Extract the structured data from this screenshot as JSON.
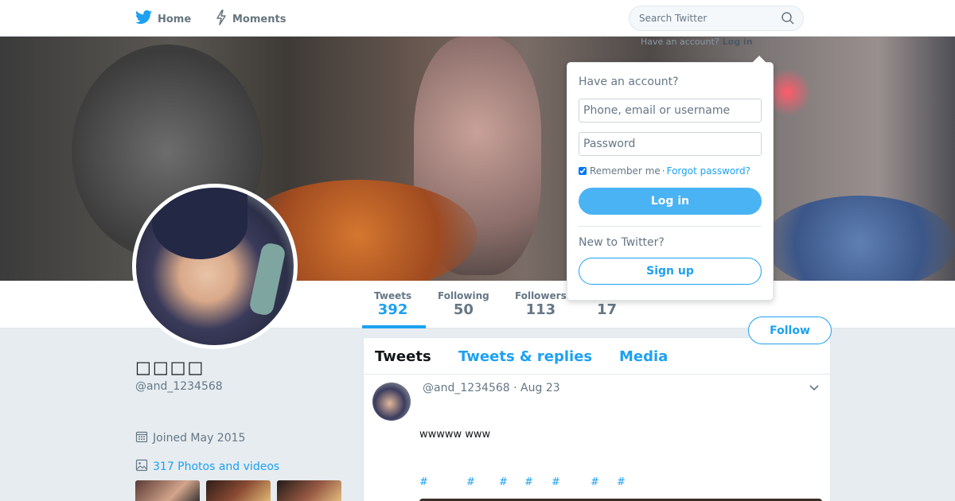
{
  "nav": {
    "home_label": "Home",
    "moments_label": "Moments",
    "search_placeholder": "Search Twitter",
    "have_account_text": "Have an account?",
    "login_link": "Log in"
  },
  "stats": {
    "tweets_label": "Tweets",
    "tweets_value": "392",
    "following_label": "Following",
    "following_value": "50",
    "followers_label": "Followers",
    "followers_value": "113",
    "likes_value": "17"
  },
  "profile": {
    "name": "□□□□",
    "handle": "@and_1234568",
    "joined": "Joined May 2015",
    "photos_link": "317 Photos and videos",
    "follow_label": "Follow"
  },
  "timeline": {
    "tabs": [
      "Tweets",
      "Tweets & replies",
      "Media"
    ],
    "tweet": {
      "meta": "@and_1234568 · Aug 23",
      "text": "wwwww www",
      "hashtags": [
        "#",
        "#",
        "#",
        "#",
        "#",
        "#",
        "#"
      ]
    }
  },
  "login_dropdown": {
    "title": "Have an account?",
    "username_placeholder": "Phone, email or username",
    "password_placeholder": "Password",
    "remember_label": "Remember me",
    "separator": "·",
    "forgot_link": "Forgot password?",
    "login_button": "Log in",
    "new_text": "New to Twitter?",
    "signup_button": "Sign up"
  },
  "icons": {
    "home": "twitter-bird-icon",
    "moments": "lightning-icon",
    "search": "search-icon",
    "calendar": "calendar-icon",
    "photos": "image-icon",
    "caret": "chevron-down-icon"
  },
  "colors": {
    "accent": "#1da1f2",
    "background": "#e6ecf0",
    "login_button": "#4ab3f4"
  }
}
